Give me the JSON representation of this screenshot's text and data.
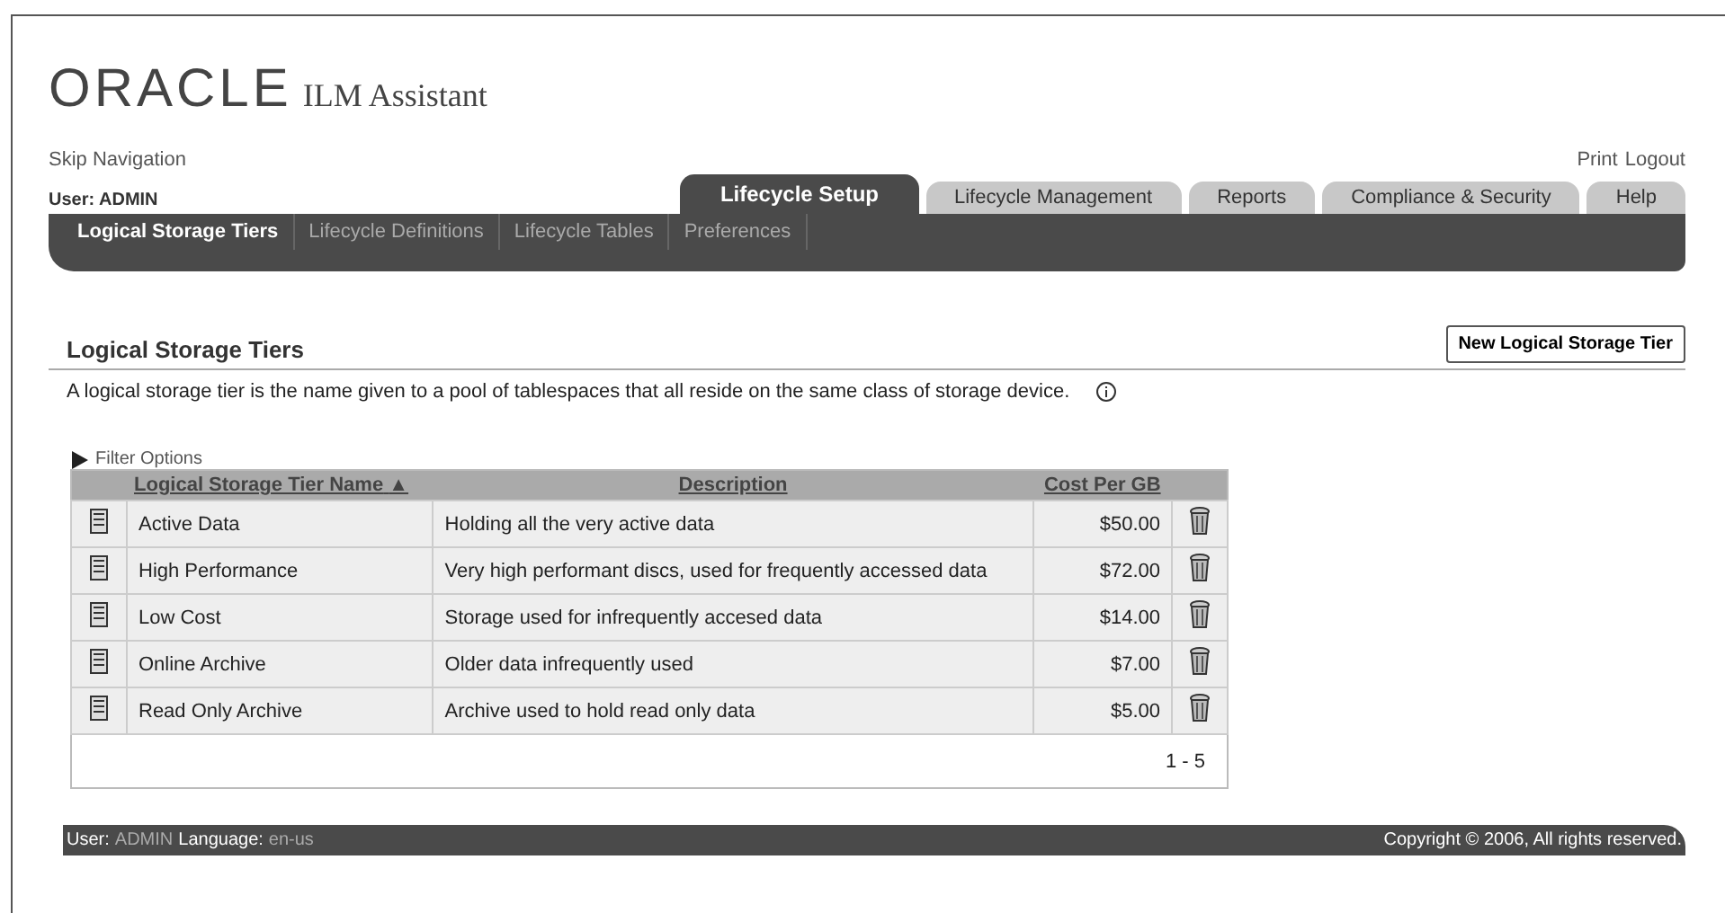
{
  "header": {
    "logo": "ORACLE",
    "product": "ILM Assistant"
  },
  "skip_link": "Skip Navigation",
  "global_links": [
    "Print",
    "Logout"
  ],
  "user": {
    "label": "User:",
    "value": "ADMIN"
  },
  "tabs": [
    {
      "label": "Lifecycle Setup",
      "selected": true
    },
    {
      "label": "Lifecycle Management",
      "selected": false
    },
    {
      "label": "Reports",
      "selected": false
    },
    {
      "label": "Compliance & Security",
      "selected": false
    },
    {
      "label": "Help",
      "selected": false
    }
  ],
  "subtabs": [
    {
      "label": "Logical Storage Tiers",
      "selected": true
    },
    {
      "label": "Lifecycle Definitions",
      "selected": false
    },
    {
      "label": "Lifecycle Tables",
      "selected": false
    },
    {
      "label": "Preferences",
      "selected": false
    }
  ],
  "section": {
    "title": "Logical Storage Tiers",
    "button": "New Logical Storage Tier",
    "description": "A logical storage tier is the name given to a pool of tablespaces that all reside on the same class of storage device."
  },
  "filter": {
    "label": "Filter Options",
    "expanded": false
  },
  "table": {
    "columns": [
      {
        "label": "Logical Storage Tier Name",
        "sort": "▲"
      },
      {
        "label": "Description"
      },
      {
        "label": "Cost Per GB"
      }
    ],
    "rows": [
      {
        "name": "Active Data",
        "description": "Holding all the very active data",
        "cost": "$50.00"
      },
      {
        "name": "High Performance",
        "description": "Very high performant discs, used for frequently accessed data",
        "cost": "$72.00"
      },
      {
        "name": "Low Cost",
        "description": "Storage used for infrequently accesed data",
        "cost": "$14.00"
      },
      {
        "name": "Online Archive",
        "description": "Older data infrequently used",
        "cost": "$7.00"
      },
      {
        "name": "Read Only Archive",
        "description": "Archive used to hold read only data",
        "cost": "$5.00"
      }
    ],
    "range": "1 - 5"
  },
  "footer": {
    "user_label": "User:",
    "user": "ADMIN",
    "language_label": "Language:",
    "language": "en-us",
    "copyright": "Copyright © 2006, All rights reserved."
  }
}
